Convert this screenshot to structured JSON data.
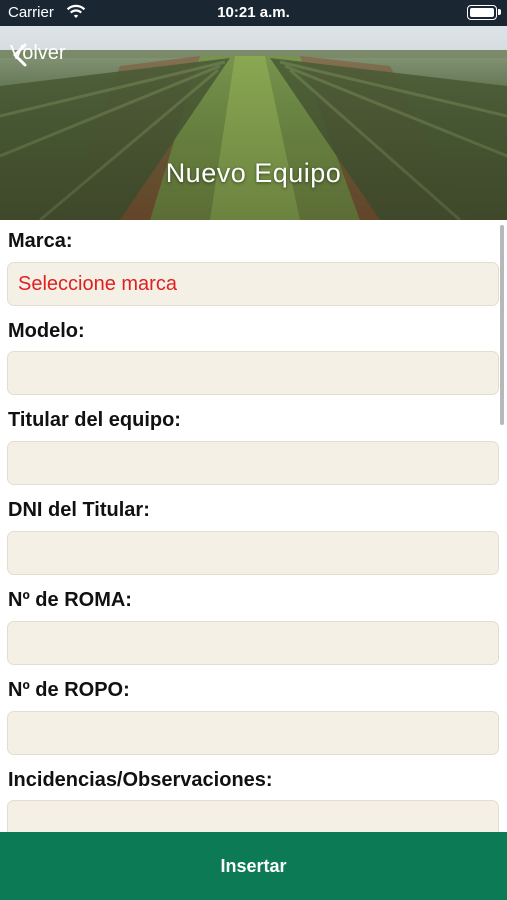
{
  "status_bar": {
    "carrier": "Carrier",
    "time": "10:21 a.m."
  },
  "nav": {
    "back_label": "Volver",
    "title": "Nuevo Equipo"
  },
  "form": {
    "fields": [
      {
        "label": "Marca:",
        "value": "Seleccione marca"
      },
      {
        "label": "Modelo:",
        "value": ""
      },
      {
        "label": "Titular del equipo:",
        "value": ""
      },
      {
        "label": "DNI del Titular:",
        "value": ""
      },
      {
        "label": "Nº de ROMA:",
        "value": ""
      },
      {
        "label": "Nº de ROPO:",
        "value": ""
      },
      {
        "label": "Incidencias/Observaciones:",
        "value": ""
      }
    ]
  },
  "footer": {
    "insert_label": "Insertar"
  },
  "colors": {
    "accent": "#0b7a55",
    "field_bg": "#f5f0e6",
    "placeholder_red": "#e02020",
    "status_bg": "#1b2633"
  },
  "icons": {
    "back": "chevron-left-icon",
    "wifi": "wifi-icon",
    "battery": "battery-icon"
  }
}
